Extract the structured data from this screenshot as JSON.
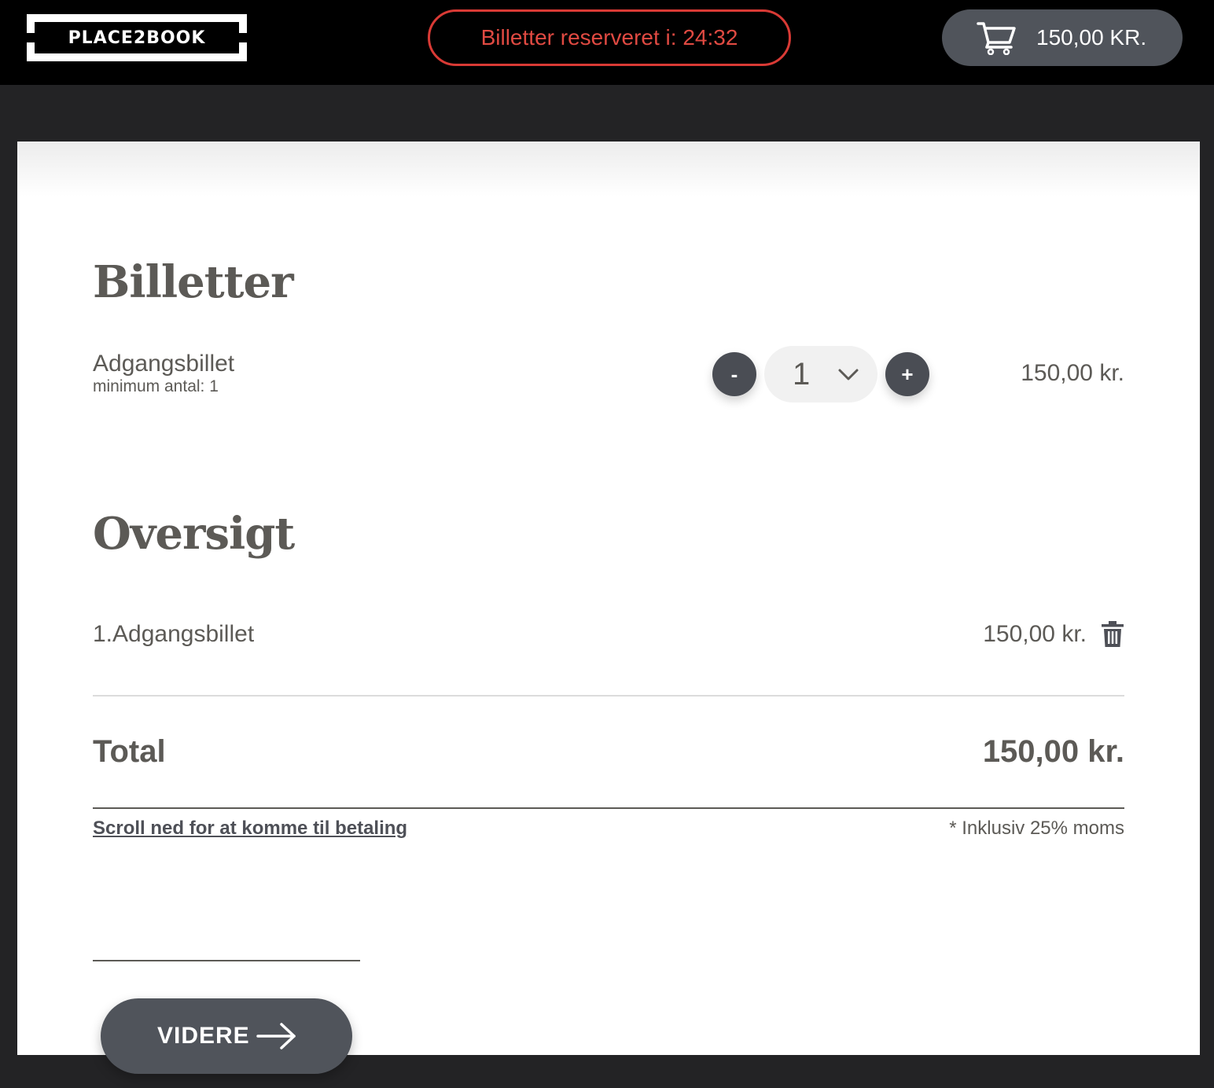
{
  "header": {
    "logo_text": "PLACE2BOOK",
    "timer_text": "Billetter reserveret i: 24:32",
    "cart_total": "150,00 KR.",
    "cart_icon": "shopping-cart-icon"
  },
  "tickets": {
    "heading": "Billetter",
    "item": {
      "name": "Adgangsbillet",
      "minimum": "minimum antal: 1",
      "decrement_label": "-",
      "increment_label": "+",
      "quantity": "1",
      "price": "150,00 kr."
    }
  },
  "overview": {
    "heading": "Oversigt",
    "lines": [
      {
        "label": "1.Adgangsbillet",
        "price": "150,00 kr.",
        "remove_icon": "trash-icon"
      }
    ],
    "total_label": "Total",
    "total_value": "150,00 kr.",
    "scroll_link": "Scroll ned for at komme til betaling",
    "vat_note": "* Inklusiv 25% moms"
  },
  "footer": {
    "next_label": "VIDERE",
    "next_icon": "arrow-right-icon"
  },
  "colors": {
    "timer_accent": "#d93a35",
    "button_bg": "#50545b",
    "text": "#5c5a56",
    "header_bg": "#000000"
  }
}
